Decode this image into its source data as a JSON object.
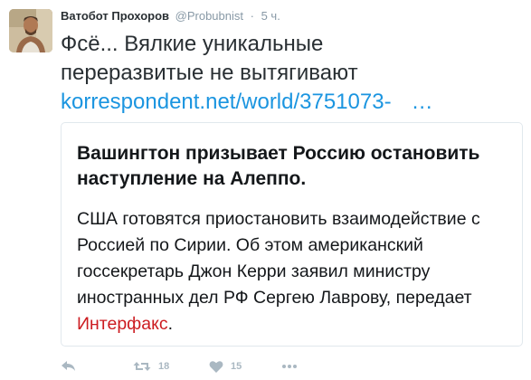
{
  "tweet": {
    "author_name": "Ватобот Прохоров",
    "author_handle": "@Probubnist",
    "separator": "·",
    "time": "5 ч.",
    "text_line1": "Фсё... Вялкие уникальные",
    "text_line2": "переразвитые не вытягивают",
    "link_text": "korrespondent.net/world/3751073-",
    "link_ellipsis": "…"
  },
  "card": {
    "title": "Вашингтон призывает Россию остановить наступление на Алеппо.",
    "body": "США готовятся приостановить взаимодействие с Россией по Сирии. Об этом американский госсекретарь Джон Керри заявил министру иностранных дел РФ Сергею Лаврову, передает ",
    "source": "Интерфакс",
    "end": "."
  },
  "actions": {
    "retweet_count": "18",
    "like_count": "15"
  },
  "colors": {
    "link": "#1b95e0",
    "source": "#cc1b20",
    "muted": "#8899a6",
    "action": "#aab8c2"
  },
  "icons": [
    "reply-icon",
    "retweet-icon",
    "heart-icon",
    "more-icon"
  ]
}
